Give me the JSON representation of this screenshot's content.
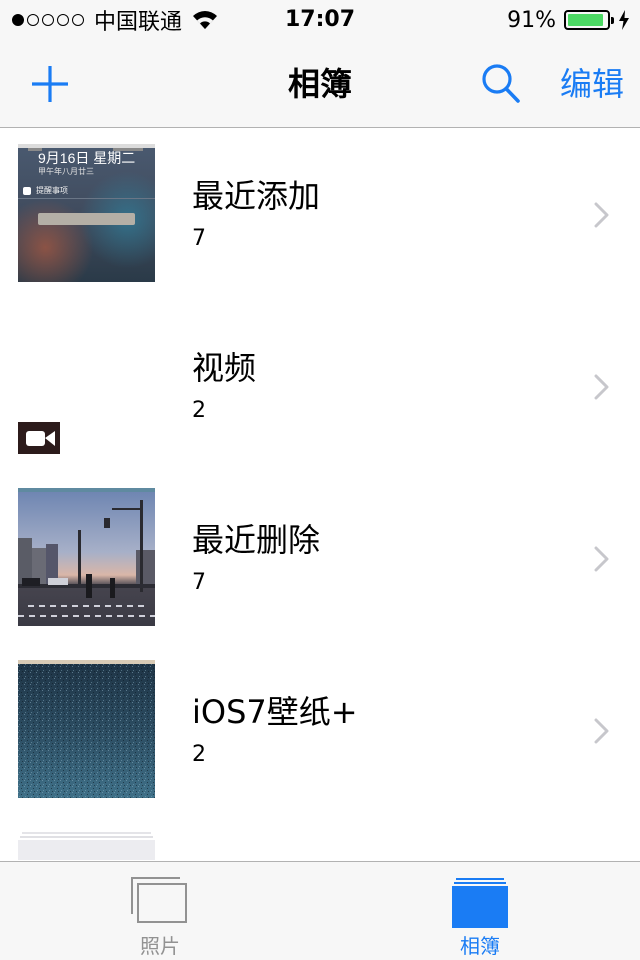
{
  "status_bar": {
    "carrier": "中国联通",
    "time": "17:07",
    "battery_percent": "91%",
    "battery_level": 0.91,
    "signal_bars_filled": 1,
    "signal_bars_total": 5
  },
  "nav": {
    "title": "相簿",
    "add_icon": "plus-icon",
    "search_icon": "search-icon",
    "edit_label": "编辑"
  },
  "albums": [
    {
      "name": "最近添加",
      "count": "7",
      "thumb_text": {
        "date": "9月16日 星期二",
        "sub": "甲午年八月廿三",
        "item": "提醒事项"
      }
    },
    {
      "name": "视频",
      "count": "2"
    },
    {
      "name": "最近删除",
      "count": "7"
    },
    {
      "name": "iOS7壁纸+",
      "count": "2"
    }
  ],
  "tabs": [
    {
      "label": "照片",
      "icon": "photos-tab-icon",
      "selected": false
    },
    {
      "label": "相簿",
      "icon": "albums-tab-icon",
      "selected": true
    }
  ],
  "colors": {
    "accent": "#1a7cf4",
    "bar_background": "#f7f7f7",
    "battery": "#4cd964",
    "tab_inactive": "#929292",
    "chevron": "#c7c7cc"
  }
}
